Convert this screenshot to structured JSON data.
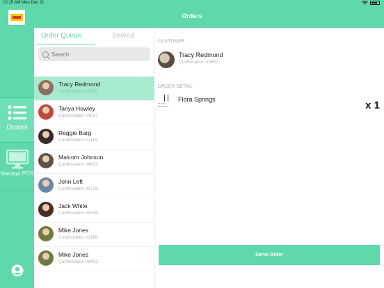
{
  "status_bar": {
    "time_date": "10:15 AM   Mon Dec 21"
  },
  "header": {
    "title": "Orders"
  },
  "rail": {
    "orders_label": "Orders",
    "pos_label": "Manage POS"
  },
  "list": {
    "tabs": [
      "Order Queue",
      "Served"
    ],
    "active_tab": "Order Queue",
    "search_placeholder": "Search",
    "items": [
      {
        "name": "Tracy Redmond",
        "confirmation": "Confirmation #3657",
        "selected": true,
        "avatar_color": "#8a6f5e"
      },
      {
        "name": "Tanya Howley",
        "confirmation": "Confirmation #4817",
        "selected": false,
        "avatar_color": "#c04a3a"
      },
      {
        "name": "Reggie Barg",
        "confirmation": "Confirmation #1116",
        "selected": false,
        "avatar_color": "#3a2b2b"
      },
      {
        "name": "Malcom Johnson",
        "confirmation": "Confirmation #4023",
        "selected": false,
        "avatar_color": "#5b5346"
      },
      {
        "name": "John Left",
        "confirmation": "Confirmation #9728",
        "selected": false,
        "avatar_color": "#6b86a8"
      },
      {
        "name": "Jack White",
        "confirmation": "Confirmation #9346",
        "selected": false,
        "avatar_color": "#4a2c24"
      },
      {
        "name": "Mike Jones",
        "confirmation": "Confirmation #3768",
        "selected": false,
        "avatar_color": "#6f7a3e"
      },
      {
        "name": "Mike Jones",
        "confirmation": "Confirmation #9422",
        "selected": false,
        "avatar_color": "#6f7a3e"
      }
    ]
  },
  "detail": {
    "customer_label": "CUSTOMER",
    "customer_name": "Tracy Redmond",
    "customer_confirmation": "Confirmation #3657",
    "order_detail_label": "ORDER DETAIL",
    "item_name": "Flora Springs",
    "item_logo_text": "FLORA SPRINGS",
    "item_quantity": "x 1",
    "serve_button": "Serve Order"
  },
  "colors": {
    "accent": "#5fd9ac",
    "selected_row": "#a8ead0"
  }
}
